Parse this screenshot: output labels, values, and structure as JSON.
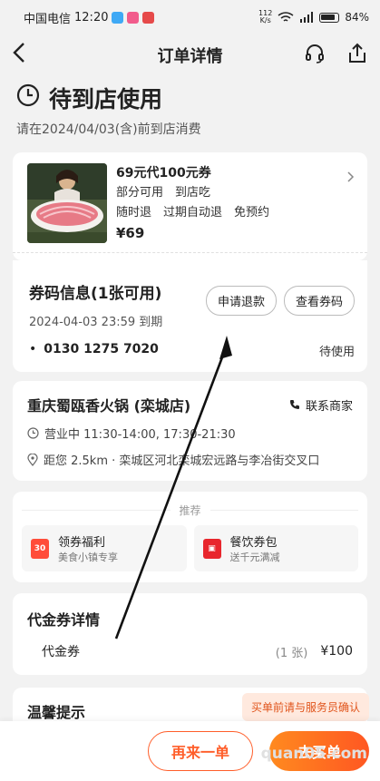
{
  "statusbar": {
    "carrier": "中国电信",
    "time": "12:20",
    "net_speed": "112\nK/s",
    "battery": "84%"
  },
  "nav": {
    "title": "订单详情",
    "back_icon": "chevron-left-icon",
    "service_icon": "headset-icon",
    "share_icon": "share-icon"
  },
  "status": {
    "title": "待到店使用",
    "subtitle": "请在2024/04/03(含)前到店消费"
  },
  "product": {
    "title": "69元代100元券",
    "line1": "部分可用　到店吃",
    "line2": "随时退　过期自动退　免预约",
    "price": "¥69"
  },
  "coupon": {
    "title": "券码信息(1张可用)",
    "expire": "2024-04-03 23:59 到期",
    "refund_label": "申请退款",
    "view_label": "查看券码",
    "code": "0130 1275 7020",
    "state": "待使用"
  },
  "store": {
    "name": "重庆蜀瓯香火锅 (栾城店)",
    "contact": "联系商家",
    "hours": "营业中 11:30-14:00, 17:30-21:30",
    "address": "距您 2.5km · 栾城区河北栾城宏远路与李冶街交叉口"
  },
  "recommend": {
    "header": "推荐",
    "items": [
      {
        "title": "领券福利",
        "sub": "美食小镇专享",
        "icon_text": "30"
      },
      {
        "title": "餐饮券包",
        "sub": "送千元满减",
        "icon_text": "▣"
      }
    ]
  },
  "voucher": {
    "title": "代金券详情",
    "name": "代金券",
    "count": "(1 张)",
    "value": "¥100"
  },
  "tips": {
    "title": "温馨提示"
  },
  "bottom": {
    "tooltip": "买单前请与服务员确认",
    "again_label": "再来一单",
    "buy_label": "去买单",
    "watermark": "quan05.com"
  },
  "colors": {
    "accent": "#ff5e2a"
  }
}
